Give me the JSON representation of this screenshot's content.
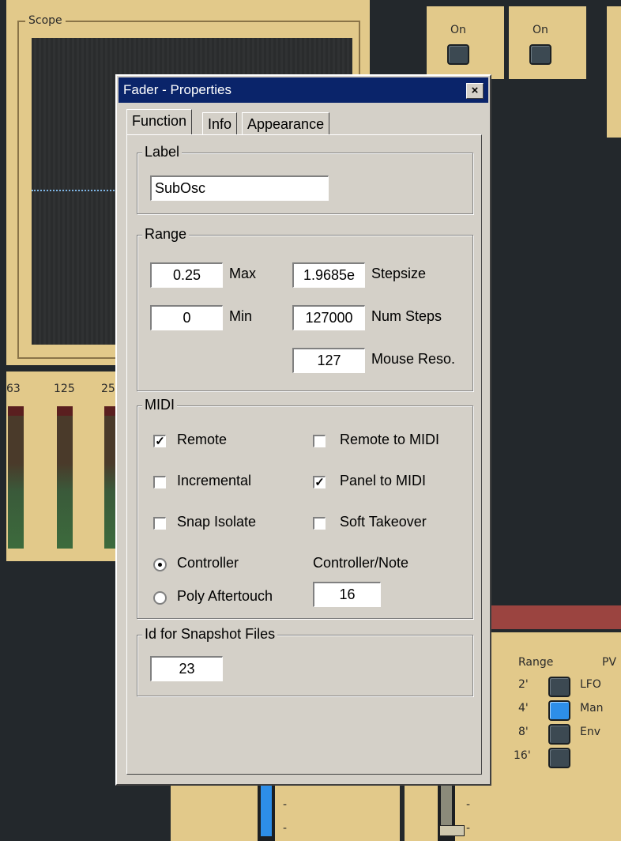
{
  "background": {
    "scope_title": "Scope",
    "on_buttons": [
      "On",
      "On"
    ],
    "meter_labels": [
      "63",
      "125",
      "25"
    ],
    "range_header": "Range",
    "pw_header": "PV",
    "range_items": [
      "2'",
      "4'",
      "8'",
      "16'"
    ],
    "pw_items": [
      "LFO",
      "Man",
      "Env"
    ],
    "fader_marks": [
      "-",
      "-",
      "-",
      "-"
    ]
  },
  "dialog": {
    "title": "Fader - Properties",
    "close_glyph": "×",
    "tabs": [
      "Function",
      "Info",
      "Appearance"
    ],
    "label_group": {
      "title": "Label",
      "value": "SubOsc"
    },
    "range_group": {
      "title": "Range",
      "max_value": "0.25",
      "max_label": "Max",
      "min_value": "0",
      "min_label": "Min",
      "stepsize_value": "1.9685e",
      "stepsize_label": "Stepsize",
      "numsteps_value": "127000",
      "numsteps_label": "Num Steps",
      "mousereso_value": "127",
      "mousereso_label": "Mouse Reso."
    },
    "midi_group": {
      "title": "MIDI",
      "remote": {
        "label": "Remote",
        "checked": true
      },
      "remote_to_midi": {
        "label": "Remote to MIDI",
        "checked": false
      },
      "incremental": {
        "label": "Incremental",
        "checked": false
      },
      "panel_to_midi": {
        "label": "Panel to MIDI",
        "checked": true
      },
      "snap_isolate": {
        "label": "Snap Isolate",
        "checked": false
      },
      "soft_takeover": {
        "label": "Soft Takeover",
        "checked": false
      },
      "controller": {
        "label": "Controller",
        "selected": true
      },
      "poly_aftertouch": {
        "label": "Poly Aftertouch",
        "selected": false
      },
      "controller_note_label": "Controller/Note",
      "controller_note_value": "16"
    },
    "snapshot_group": {
      "title": "Id for Snapshot Files",
      "value": "23"
    }
  },
  "colors": {
    "panel_tan": "#e2c98a",
    "dialog_face": "#d4d0c8",
    "titlebar": "#0a246a",
    "led_on": "#2d8ee8"
  }
}
